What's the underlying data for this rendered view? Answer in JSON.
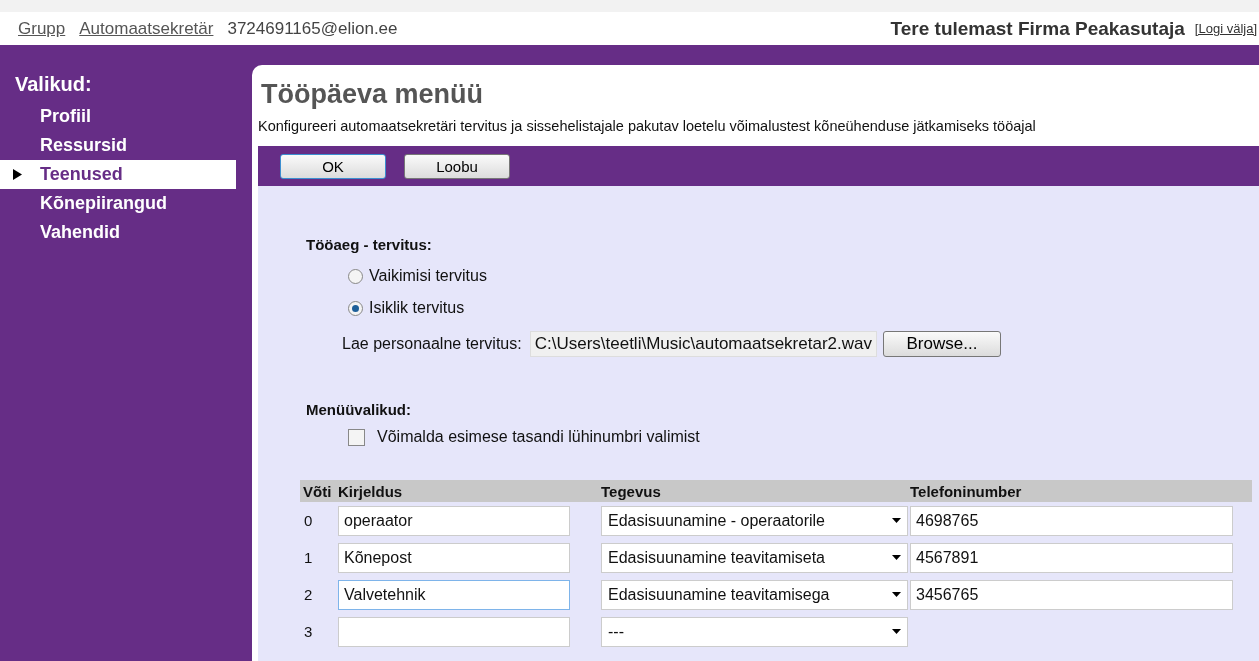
{
  "top_bar": {
    "links": [
      "Grupp",
      "Automaatsekretär"
    ],
    "account": "3724691165@elion.ee",
    "welcome": "Tere tulemast Firma Peakasutaja",
    "logout": "[Logi välja]"
  },
  "sidebar": {
    "title": "Valikud:",
    "items": [
      {
        "label": "Profiil",
        "selected": false
      },
      {
        "label": "Ressursid",
        "selected": false
      },
      {
        "label": "Teenused",
        "selected": true
      },
      {
        "label": "Kõnepiirangud",
        "selected": false
      },
      {
        "label": "Vahendid",
        "selected": false
      }
    ]
  },
  "page": {
    "title": "Tööpäeva menüü",
    "description": "Konfigureeri automaatsekretäri tervitus ja sissehelistajale pakutav loetelu võimalustest kõneühenduse jätkamiseks tööajal"
  },
  "toolbar": {
    "buttons": [
      "OK",
      "Loobu"
    ]
  },
  "greeting": {
    "heading": "Tööaeg - tervitus:",
    "options": [
      {
        "label": "Vaikimisi tervitus",
        "selected": false
      },
      {
        "label": "Isiklik tervitus",
        "selected": true
      }
    ],
    "upload_label": "Lae personaalne tervitus:",
    "file_value": "C:\\Users\\teetli\\Music\\automaatsekretar2.wav",
    "browse_button": "Browse..."
  },
  "menu_options": {
    "heading": "Menüüvalikud:",
    "checkbox": {
      "label": "Võimalda esimese tasandi lühinumbri valimist",
      "checked": false
    }
  },
  "table": {
    "columns": [
      "Võti",
      "Kirjeldus",
      "Tegevus",
      "Telefoninumber"
    ],
    "rows": [
      {
        "key": "0",
        "description": "operaator",
        "action": "Edasisuunamine - operaatorile",
        "phone": "4698765",
        "focused": false
      },
      {
        "key": "1",
        "description": "Kõnepost",
        "action": "Edasisuunamine teavitamiseta",
        "phone": "4567891",
        "focused": false
      },
      {
        "key": "2",
        "description": "Valvetehnik",
        "action": "Edasisuunamine teavitamisega",
        "phone": "3456765",
        "focused": true
      },
      {
        "key": "3",
        "action": "---",
        "focused": false
      }
    ]
  }
}
